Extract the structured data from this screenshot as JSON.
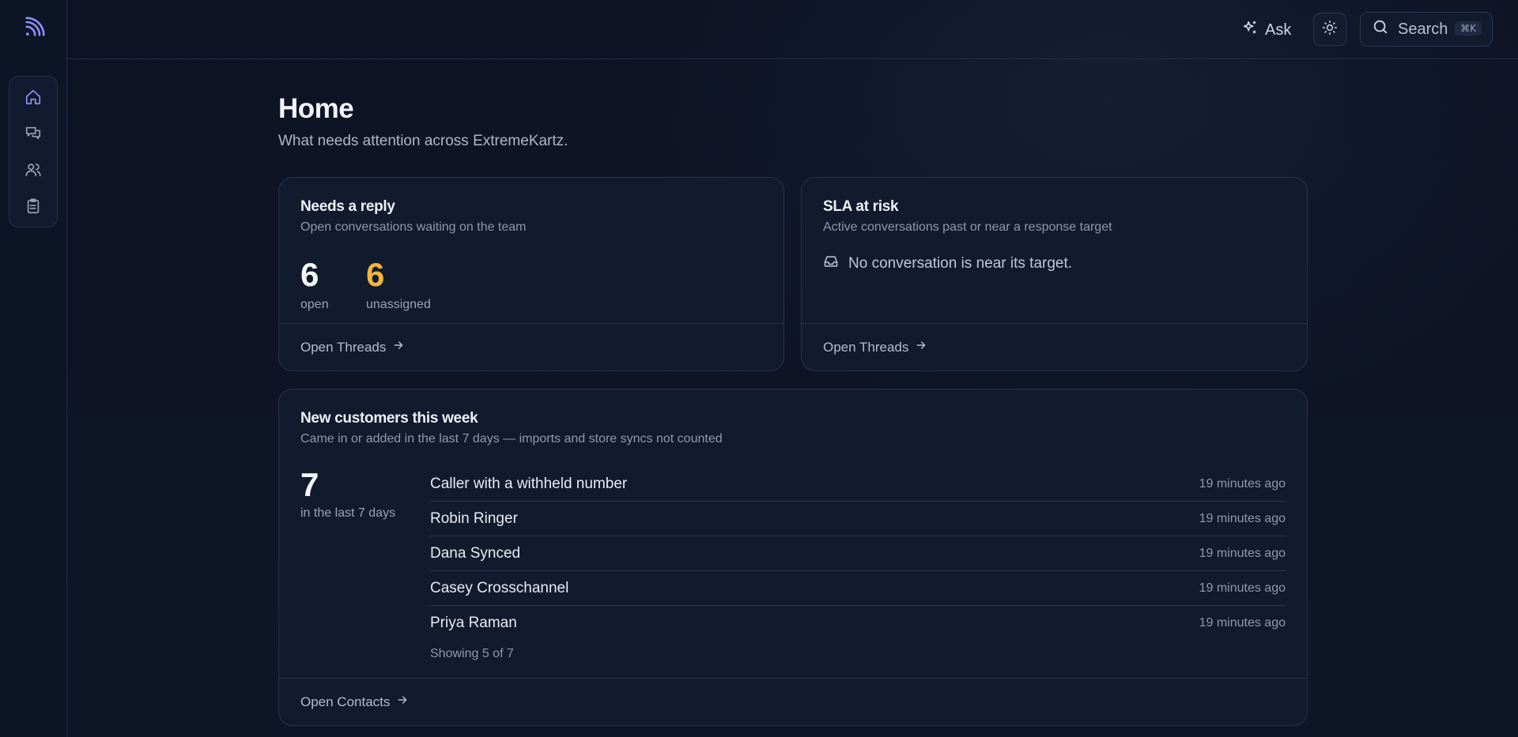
{
  "header": {
    "ask_label": "Ask",
    "search_label": "Search",
    "search_shortcut": "⌘K"
  },
  "sidebar": {
    "items": [
      {
        "name": "home",
        "icon": "home-icon"
      },
      {
        "name": "threads",
        "icon": "chat-bubbles-icon"
      },
      {
        "name": "contacts",
        "icon": "users-icon"
      },
      {
        "name": "tasks",
        "icon": "clipboard-icon"
      }
    ]
  },
  "page": {
    "title": "Home",
    "subtitle": "What needs attention across ExtremeKartz."
  },
  "needs_reply": {
    "title": "Needs a reply",
    "subtitle": "Open conversations waiting on the team",
    "open_count": "6",
    "open_label": "open",
    "unassigned_count": "6",
    "unassigned_label": "unassigned",
    "footer_label": "Open Threads"
  },
  "sla": {
    "title": "SLA at risk",
    "subtitle": "Active conversations past or near a response target",
    "empty_message": "No conversation is near its target.",
    "footer_label": "Open Threads"
  },
  "new_customers": {
    "title": "New customers this week",
    "subtitle": "Came in or added in the last 7 days — imports and store syncs not counted",
    "count": "7",
    "count_label": "in the last 7 days",
    "rows": [
      {
        "name": "Caller with a withheld number",
        "time": "19 minutes ago"
      },
      {
        "name": "Robin Ringer",
        "time": "19 minutes ago"
      },
      {
        "name": "Dana Synced",
        "time": "19 minutes ago"
      },
      {
        "name": "Casey Crosschannel",
        "time": "19 minutes ago"
      },
      {
        "name": "Priya Raman",
        "time": "19 minutes ago"
      }
    ],
    "showing_text": "Showing 5 of 7",
    "footer_label": "Open Contacts"
  },
  "colors": {
    "accent": "#7b86f5",
    "warning": "#f5b53a",
    "background": "#0c1222",
    "card": "#121a2e"
  }
}
